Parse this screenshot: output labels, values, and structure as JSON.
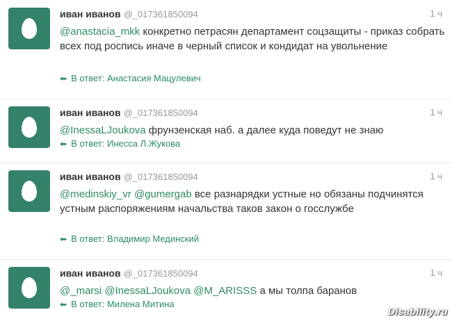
{
  "tweets": [
    {
      "name": "иван иванов",
      "handle": "@_017361850094",
      "time": "1 ч",
      "mentions": [
        "@anastacia_mkk"
      ],
      "text": " конкретно петрасян департамент соцзащиты - приказ собрать всех под роспись иначе в черный список и кондидат на увольнение",
      "reply_label": "В ответ: Анастасия Мацулевич"
    },
    {
      "name": "иван иванов",
      "handle": "@_017361850094",
      "time": "1 ч",
      "mentions": [
        "@InessaLJoukova"
      ],
      "text": " фрунзенская наб. а далее куда поведут не знаю",
      "reply_label": "В ответ: Инесса Л.Жукова"
    },
    {
      "name": "иван иванов",
      "handle": "@_017361850094",
      "time": "1 ч",
      "mentions": [
        "@medinskiy_vr",
        "@gumergab"
      ],
      "text": " все разнарядки устные но обязаны подчинятся устным распоряжениям начальства таков закон о госслужбе",
      "reply_label": "В ответ: Владимир Мединский"
    },
    {
      "name": "иван иванов",
      "handle": "@_017361850094",
      "time": "1 ч",
      "mentions": [
        "@_marsi",
        "@InessaLJoukova",
        "@M_ARISSS"
      ],
      "text": " а мы толпа баранов",
      "reply_label": "В ответ: Милена Митина"
    }
  ],
  "watermark": "Disability.ru",
  "colors": {
    "avatar": "#35826c",
    "mention": "#2f8c5e",
    "reply": "#2a8a6a"
  },
  "icons": {
    "avatar": "egg-avatar-icon",
    "reply": "reply-arrow-icon"
  }
}
